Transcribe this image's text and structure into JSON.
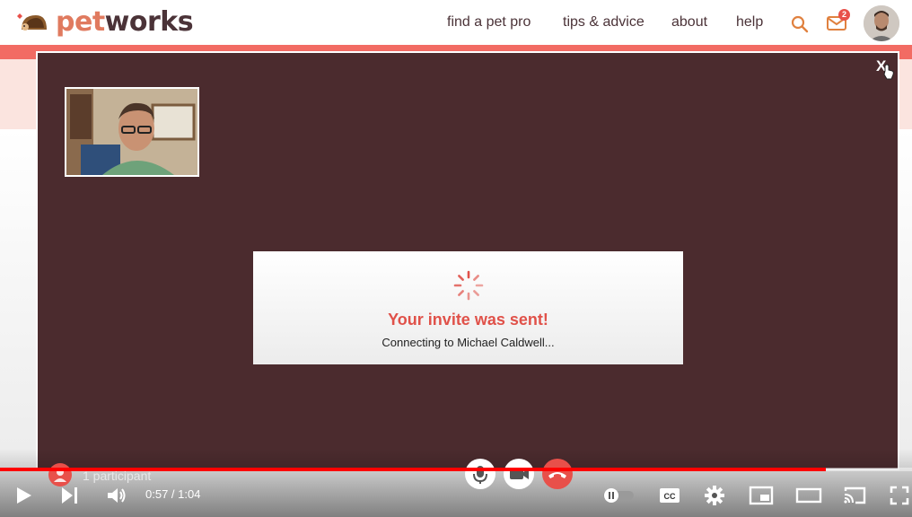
{
  "site": {
    "logo_pet": "pet",
    "logo_works": "works",
    "nav": [
      "find a pet pro",
      "tips & advice",
      "about",
      "help"
    ],
    "notification_count": "2",
    "colors": {
      "brand": "#e07a5f",
      "accent": "#f26b63",
      "modal_bg": "#4b2b2e"
    }
  },
  "modal": {
    "close_label": "X",
    "invite_title": "Your invite was sent!",
    "invite_subtitle": "Connecting to Michael Caldwell..."
  },
  "call": {
    "participant_count_label": "1 participant",
    "controls": [
      "microphone-icon",
      "camera-icon",
      "hang-up-icon"
    ]
  },
  "player": {
    "time": "0:57 / 1:04",
    "progress": 0.906,
    "icons": [
      "play-icon",
      "next-icon",
      "volume-icon",
      "autoplay-toggle-icon",
      "captions-icon",
      "settings-icon",
      "miniplayer-icon",
      "theater-icon",
      "cast-icon",
      "fullscreen-icon"
    ]
  }
}
